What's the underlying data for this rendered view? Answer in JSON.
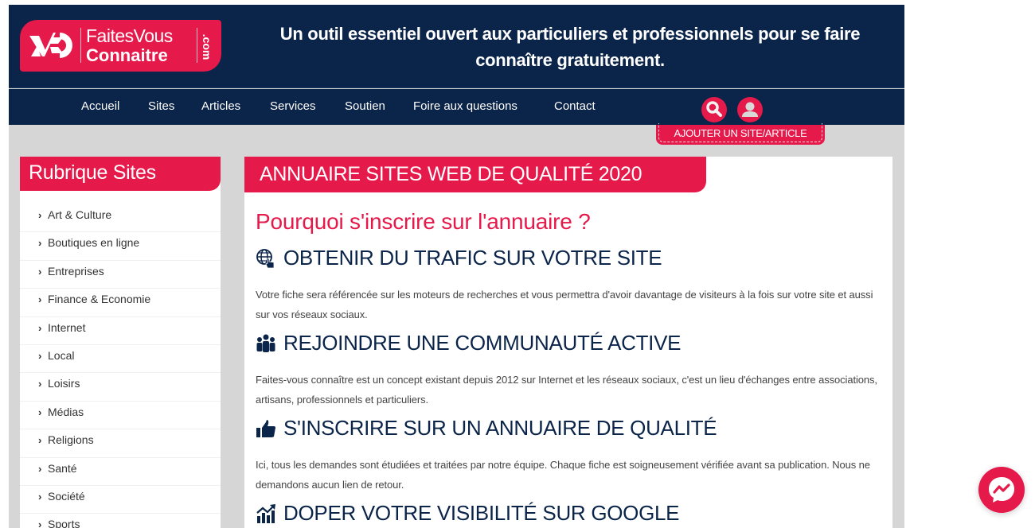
{
  "brand": {
    "logo_line1": "FaitesVous",
    "logo_line2": "Connaitre",
    "logo_suffix": ".com",
    "accent_color": "#e6194b",
    "dark_color": "#0b2449"
  },
  "header": {
    "tagline": "Un outil essentiel ouvert aux particuliers et professionnels pour se faire connaître gratuitement."
  },
  "nav": {
    "items": [
      {
        "label": "Accueil"
      },
      {
        "label": "Sites"
      },
      {
        "label": "Articles"
      },
      {
        "label": "Services"
      },
      {
        "label": "Soutien"
      },
      {
        "label": "Foire aux questions"
      },
      {
        "label": "Contact"
      }
    ],
    "icons": [
      "search-icon",
      "user-icon"
    ],
    "add_button": "AJOUTER UN SITE/ARTICLE"
  },
  "sidebar": {
    "title": "Rubrique Sites",
    "items": [
      {
        "label": "Art & Culture"
      },
      {
        "label": "Boutiques en ligne"
      },
      {
        "label": "Entreprises"
      },
      {
        "label": "Finance & Economie"
      },
      {
        "label": "Internet"
      },
      {
        "label": "Local"
      },
      {
        "label": "Loisirs"
      },
      {
        "label": "Médias"
      },
      {
        "label": "Religions"
      },
      {
        "label": "Santé"
      },
      {
        "label": "Société"
      },
      {
        "label": "Sports"
      }
    ]
  },
  "main": {
    "banner": "ANNUAIRE SITES WEB DE QUALITÉ 2020",
    "heading": "Pourquoi s'inscrire sur l'annuaire ?",
    "sections": [
      {
        "icon": "globe-click-icon",
        "title": "OBTENIR DU TRAFIC SUR VOTRE SITE",
        "text": "Votre fiche sera référencée sur les moteurs de recherches et vous permettra d'avoir davantage de visiteurs à la fois sur votre site et aussi sur vos réseaux sociaux."
      },
      {
        "icon": "users-group-icon",
        "title": "REJOINDRE UNE COMMUNAUTÉ ACTIVE",
        "text": "Faites-vous connaître est un concept existant depuis 2012 sur Internet et les réseaux sociaux, c'est un lieu d'échanges entre associations, artisans, professionnels et particuliers."
      },
      {
        "icon": "thumbs-up-icon",
        "title": "S'INSCRIRE SUR UN ANNUAIRE DE QUALITÉ",
        "text": "Ici, tous les demandes sont étudiées et traitées par notre équipe. Chaque fiche est soigneusement vérifiée avant sa publication. Nous ne demandons aucun lien de retour."
      },
      {
        "icon": "growth-chart-icon",
        "title": "DOPER VOTRE VISIBILITÉ SUR GOOGLE",
        "text": ""
      }
    ]
  },
  "widgets": {
    "messenger": "messenger-icon"
  }
}
